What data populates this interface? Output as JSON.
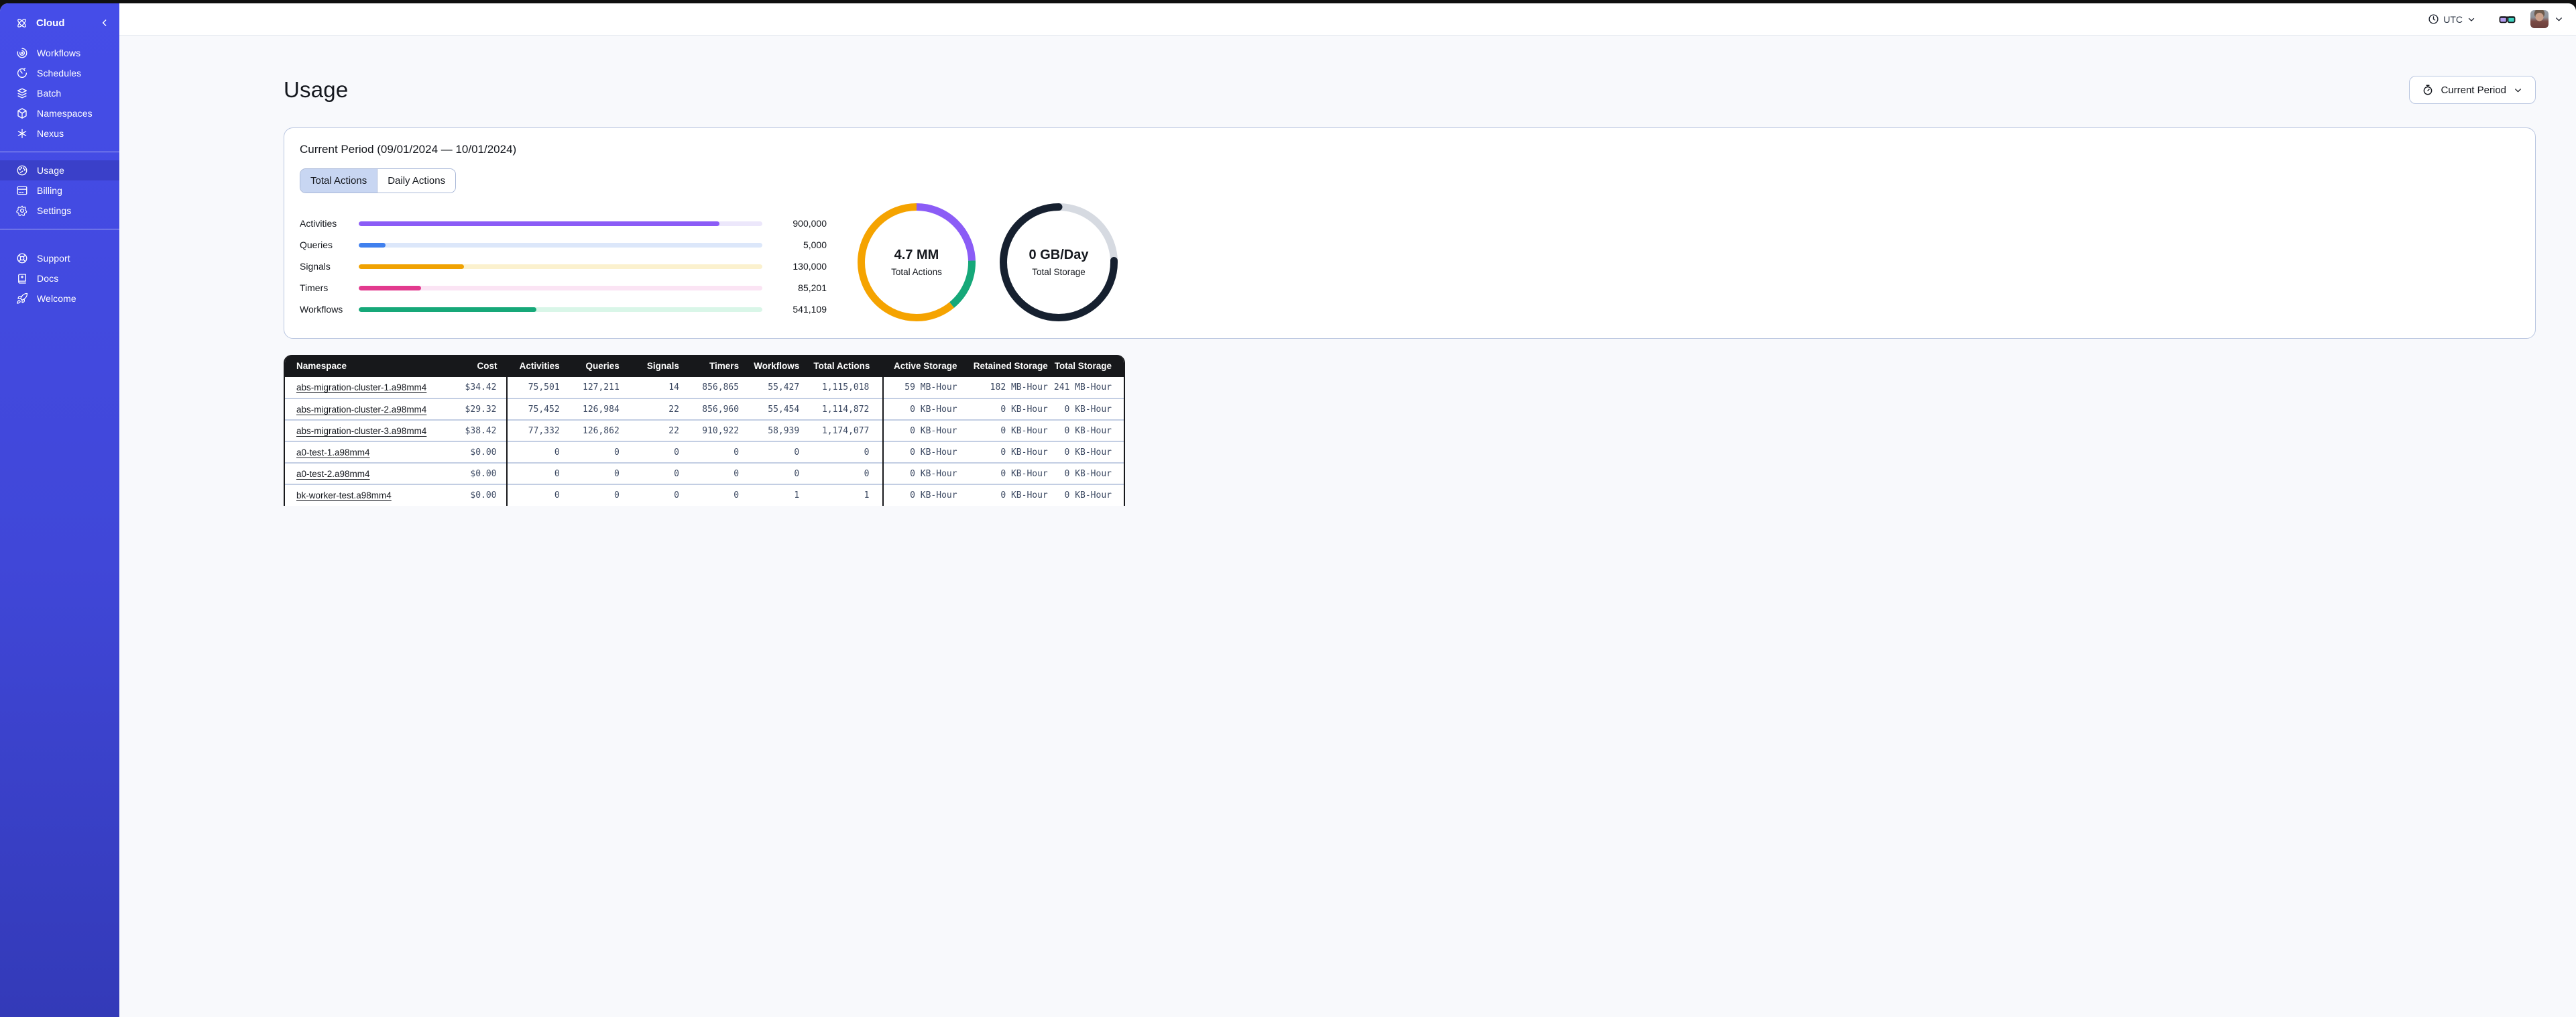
{
  "sidebar": {
    "brand": "Cloud",
    "nav": [
      {
        "label": "Workflows",
        "icon": "workflows-icon"
      },
      {
        "label": "Schedules",
        "icon": "schedules-icon"
      },
      {
        "label": "Batch",
        "icon": "batch-icon"
      },
      {
        "label": "Namespaces",
        "icon": "namespaces-icon"
      },
      {
        "label": "Nexus",
        "icon": "nexus-icon"
      }
    ],
    "account": [
      {
        "label": "Usage",
        "icon": "usage-icon",
        "active": true
      },
      {
        "label": "Billing",
        "icon": "billing-icon",
        "active": false
      },
      {
        "label": "Settings",
        "icon": "settings-icon",
        "active": false
      }
    ],
    "footer": [
      {
        "label": "Support",
        "icon": "support-icon"
      },
      {
        "label": "Docs",
        "icon": "docs-icon"
      },
      {
        "label": "Welcome",
        "icon": "welcome-icon"
      }
    ]
  },
  "topbar": {
    "timezone": "UTC"
  },
  "page": {
    "title": "Usage",
    "period_button": "Current Period"
  },
  "usage_card": {
    "title": "Current Period (09/01/2024 — 10/01/2024)",
    "tabs": [
      {
        "label": "Total Actions",
        "active": true
      },
      {
        "label": "Daily Actions",
        "active": false
      }
    ],
    "chart_data": {
      "type": "bar",
      "bars": [
        {
          "label": "Activities",
          "value": 900000,
          "display": "900,000",
          "fill_pct": 89.3,
          "color": "#8b5cf6",
          "track": "#ece7fb"
        },
        {
          "label": "Queries",
          "value": 5000,
          "display": "5,000",
          "fill_pct": 6.7,
          "color": "#4080ee",
          "track": "#dce7fa"
        },
        {
          "label": "Signals",
          "value": 130000,
          "display": "130,000",
          "fill_pct": 26.1,
          "color": "#f0a202",
          "track": "#fbf1ce"
        },
        {
          "label": "Timers",
          "value": 85201,
          "display": "85,201",
          "fill_pct": 15.5,
          "color": "#e23a8e",
          "track": "#fbe4f4"
        },
        {
          "label": "Workflows",
          "value": 541109,
          "display": "541,109",
          "fill_pct": 44.0,
          "color": "#16a879",
          "track": "#d9f6e8"
        }
      ],
      "donuts": [
        {
          "value": "4.7 MM",
          "label": "Total Actions",
          "segments": [
            {
              "color": "#8b5cf6",
              "start": 0.0,
              "frac": 0.245,
              "cap": "butt"
            },
            {
              "color": "#16a879",
              "start": 0.245,
              "frac": 0.145,
              "cap": "butt"
            },
            {
              "color": "#f5a300",
              "start": 0.39,
              "frac": 0.61,
              "cap": "butt"
            }
          ]
        },
        {
          "value": "0 GB/Day",
          "label": "Total Storage",
          "segments": [
            {
              "color": "#d6dae1",
              "start": 0.0,
              "frac": 1.0,
              "cap": "butt"
            },
            {
              "color": "#16202f",
              "start": 0.245,
              "frac": 0.755,
              "cap": "round"
            }
          ]
        }
      ]
    }
  },
  "table": {
    "columns": [
      "Namespace",
      "Cost",
      "Activities",
      "Queries",
      "Signals",
      "Timers",
      "Workflows",
      "Total Actions",
      "Active Storage",
      "Retained Storage",
      "Total Storage"
    ],
    "rows": [
      {
        "namespace": "abs-migration-cluster-1.a98mm4",
        "cost": "$34.42",
        "activities": "75,501",
        "queries": "127,211",
        "signals": "14",
        "timers": "856,865",
        "workflows": "55,427",
        "total_actions": "1,115,018",
        "active_storage": "59 MB-Hour",
        "retained_storage": "182 MB-Hour",
        "total_storage": "241 MB-Hour"
      },
      {
        "namespace": "abs-migration-cluster-2.a98mm4",
        "cost": "$29.32",
        "activities": "75,452",
        "queries": "126,984",
        "signals": "22",
        "timers": "856,960",
        "workflows": "55,454",
        "total_actions": "1,114,872",
        "active_storage": "0 KB-Hour",
        "retained_storage": "0 KB-Hour",
        "total_storage": "0 KB-Hour"
      },
      {
        "namespace": "abs-migration-cluster-3.a98mm4",
        "cost": "$38.42",
        "activities": "77,332",
        "queries": "126,862",
        "signals": "22",
        "timers": "910,922",
        "workflows": "58,939",
        "total_actions": "1,174,077",
        "active_storage": "0 KB-Hour",
        "retained_storage": "0 KB-Hour",
        "total_storage": "0 KB-Hour"
      },
      {
        "namespace": "a0-test-1.a98mm4",
        "cost": "$0.00",
        "activities": "0",
        "queries": "0",
        "signals": "0",
        "timers": "0",
        "workflows": "0",
        "total_actions": "0",
        "active_storage": "0 KB-Hour",
        "retained_storage": "0 KB-Hour",
        "total_storage": "0 KB-Hour"
      },
      {
        "namespace": "a0-test-2.a98mm4",
        "cost": "$0.00",
        "activities": "0",
        "queries": "0",
        "signals": "0",
        "timers": "0",
        "workflows": "0",
        "total_actions": "0",
        "active_storage": "0 KB-Hour",
        "retained_storage": "0 KB-Hour",
        "total_storage": "0 KB-Hour"
      },
      {
        "namespace": "bk-worker-test.a98mm4",
        "cost": "$0.00",
        "activities": "0",
        "queries": "0",
        "signals": "0",
        "timers": "0",
        "workflows": "1",
        "total_actions": "1",
        "active_storage": "0 KB-Hour",
        "retained_storage": "0 KB-Hour",
        "total_storage": "0 KB-Hour"
      }
    ]
  }
}
